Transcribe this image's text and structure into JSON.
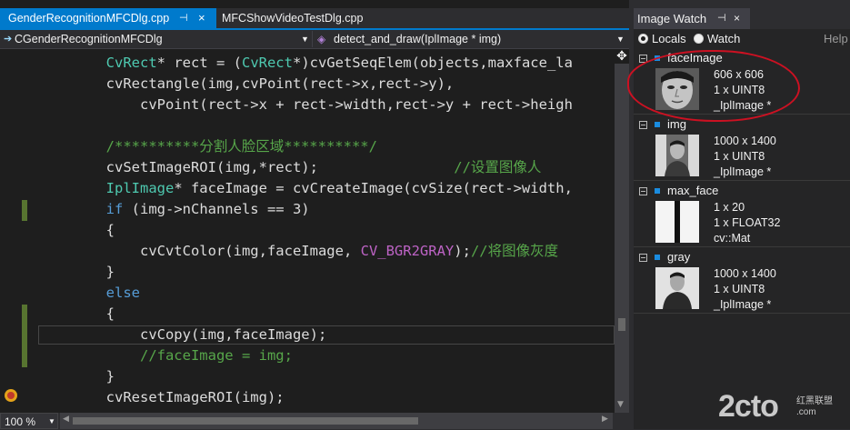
{
  "editor": {
    "tabs": [
      {
        "label": "GenderRecognitionMFCDlg.cpp",
        "active": true
      },
      {
        "label": "MFCShowVideoTestDlg.cpp",
        "active": false
      }
    ],
    "nav": {
      "class_scope": "CGenderRecognitionMFCDlg",
      "function_scope": "detect_and_draw(IplImage * img)"
    },
    "zoom": "100 %",
    "lines": [
      [
        "        ",
        "CvRect",
        "* rect = (",
        "CvRect",
        "*)cvGetSeqElem(objects,maxface_la"
      ],
      [
        "        cvRectangle(img,cvPoint(rect->x,rect->y),"
      ],
      [
        "            cvPoint(rect->x + rect->width,rect->y + rect->heigh"
      ],
      [
        ""
      ],
      [
        "        ",
        "/**********分割人脸区域**********/"
      ],
      [
        "        cvSetImageROI(img,*rect);",
        "                //设置图像人"
      ],
      [
        "        ",
        "IplImage",
        "* faceImage = cvCreateImage(cvSize(rect->width,"
      ],
      [
        "        ",
        "if",
        " (img->nChannels == 3)"
      ],
      [
        "        {"
      ],
      [
        "            cvCvtColor(img,faceImage, ",
        "CV_BGR2GRAY",
        ");",
        "//将图像灰度"
      ],
      [
        "        }"
      ],
      [
        "        ",
        "else"
      ],
      [
        "        {"
      ],
      [
        "            cvCopy(img,faceImage);"
      ],
      [
        "            ",
        "//faceImage = img;"
      ],
      [
        "        }"
      ],
      [
        "        cvResetImageROI(img);"
      ]
    ]
  },
  "image_watch": {
    "title": "Image Watch",
    "locals_label": "Locals",
    "watch_label": "Watch",
    "help_label": "Help",
    "entries": [
      {
        "name": "faceImage",
        "size": "606 x 606",
        "channels": "1 x UINT8",
        "type": "_IplImage *"
      },
      {
        "name": "img",
        "size": "1000 x 1400",
        "channels": "1 x UINT8",
        "type": "_IplImage *"
      },
      {
        "name": "max_face",
        "size": "1 x 20",
        "channels": "1 x FLOAT32",
        "type": "cv::Mat"
      },
      {
        "name": "gray",
        "size": "1000 x 1400",
        "channels": "1 x UINT8",
        "type": "_IplImage *"
      }
    ]
  },
  "watermark": {
    "text": "2cto",
    "sub1": "红黑联盟",
    "sub2": ".com"
  },
  "colors": {
    "accent": "#007acc",
    "annotation": "#cc1122",
    "type": "#4ec9b0",
    "keyword": "#569cd6",
    "comment": "#57a64a",
    "macro": "#bd63c5"
  }
}
